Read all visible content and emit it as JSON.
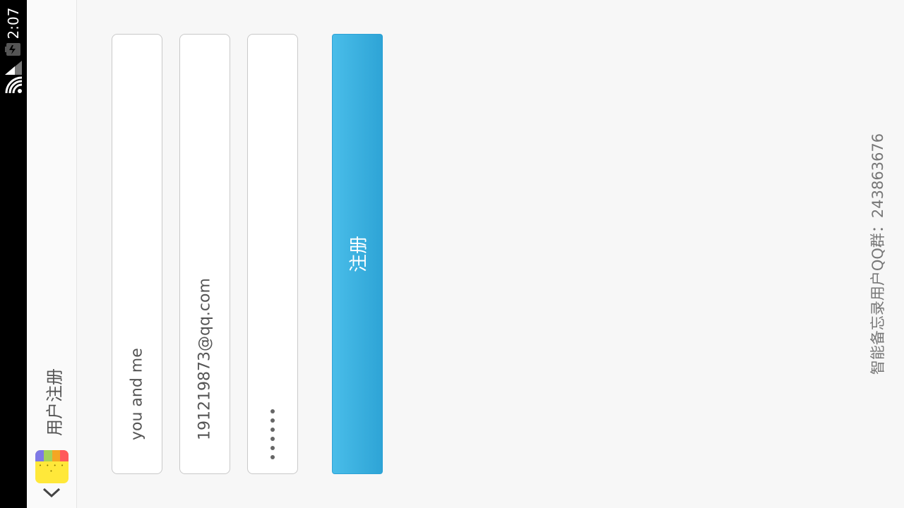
{
  "status_bar": {
    "time": "2:07"
  },
  "app_bar": {
    "title": "用户注册"
  },
  "form": {
    "username_value": "you and me",
    "email_value": "191219873@qq.com",
    "password_masked_length": 6,
    "register_label": "注册"
  },
  "footer": {
    "note": "智能备忘录用户QQ群：243863676"
  },
  "colors": {
    "accent": "#3fb3e3",
    "background": "#f7f7f7",
    "status_bar": "#000000"
  },
  "icons": {
    "status": [
      "wifi-icon",
      "signal-icon",
      "battery-icon"
    ],
    "app": "app-logo-icon",
    "navigation": "chevron-down-icon"
  }
}
